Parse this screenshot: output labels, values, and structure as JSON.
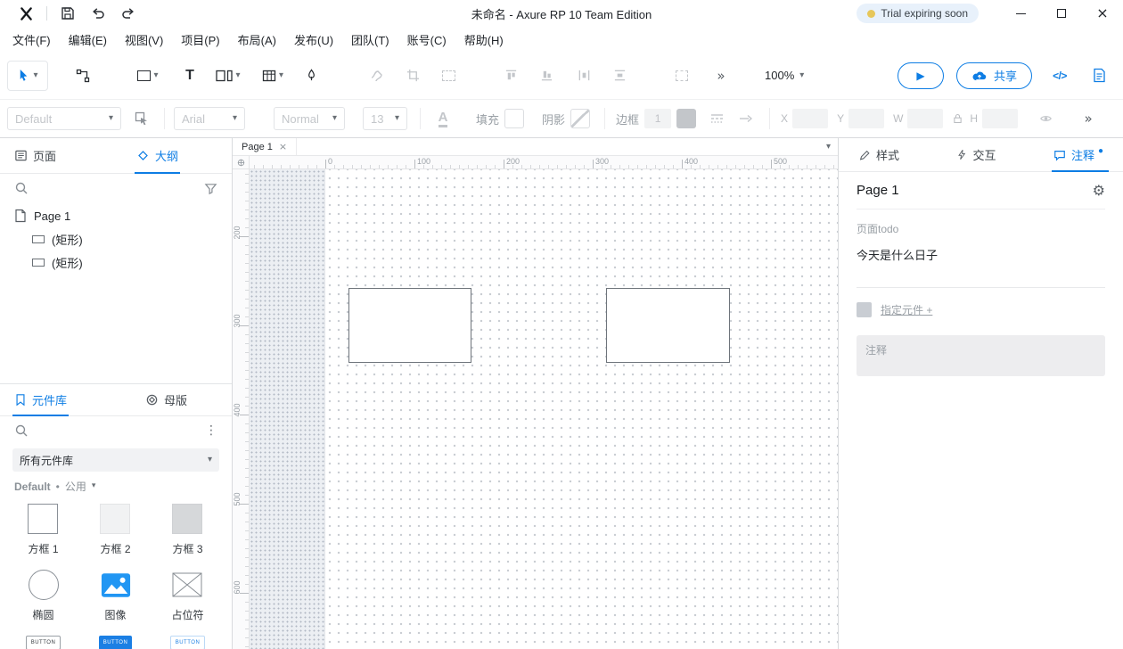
{
  "titlebar": {
    "title": "未命名 - Axure RP 10 Team Edition",
    "trial_badge": "Trial expiring soon"
  },
  "menubar": {
    "items": [
      "文件(F)",
      "编辑(E)",
      "视图(V)",
      "项目(P)",
      "布局(A)",
      "发布(U)",
      "团队(T)",
      "账号(C)",
      "帮助(H)"
    ]
  },
  "toolbar": {
    "zoom": "100%",
    "share": "共享"
  },
  "stylebar": {
    "style_preset": "Default",
    "font_family": "Arial",
    "font_weight": "Normal",
    "font_size": "13",
    "text_color": "A",
    "fill": "填充",
    "shadow": "阴影",
    "border": "边框",
    "border_width": "1",
    "x": "X",
    "y": "Y",
    "w": "W",
    "h": "H"
  },
  "left_panel": {
    "pages_tab": "页面",
    "outline_tab": "大纲",
    "tree": {
      "root": "Page 1",
      "children": [
        "(矩形)",
        "(矩形)"
      ]
    },
    "libraries": {
      "widgets_tab": "元件库",
      "masters_tab": "母版",
      "library_select": "所有元件库",
      "group_name": "Default",
      "group_scope": "公用",
      "widgets": [
        "方框 1",
        "方框 2",
        "方框 3",
        "椭圆",
        "图像",
        "占位符"
      ],
      "buttons_row": [
        "BUTTON",
        "BUTTON",
        "BUTTON"
      ]
    }
  },
  "canvas": {
    "tab": "Page 1",
    "ruler_h": [
      "0",
      "100",
      "200",
      "300",
      "400",
      "500"
    ],
    "ruler_v": [
      "200",
      "300",
      "400",
      "500",
      "600"
    ]
  },
  "right_panel": {
    "style_tab": "样式",
    "interaction_tab": "交互",
    "notes_tab": "注释",
    "page_title": "Page 1",
    "note_label": "页面todo",
    "note_value": "今天是什么日子",
    "assign_widget": "指定元件 +",
    "notes_placeholder": "注释"
  },
  "icons": {
    "caret": "▾",
    "close": "×",
    "play": "▶",
    "more": "»",
    "kebab": "⋮",
    "gear": "⚙",
    "dot": "•",
    "note_dot": "●",
    "text_tool": "T",
    "code": "</>"
  },
  "colors": {
    "accent": "#0d7de4",
    "trial_badge_bg": "#e8f1fb",
    "trial_dot": "#e7c75a"
  }
}
